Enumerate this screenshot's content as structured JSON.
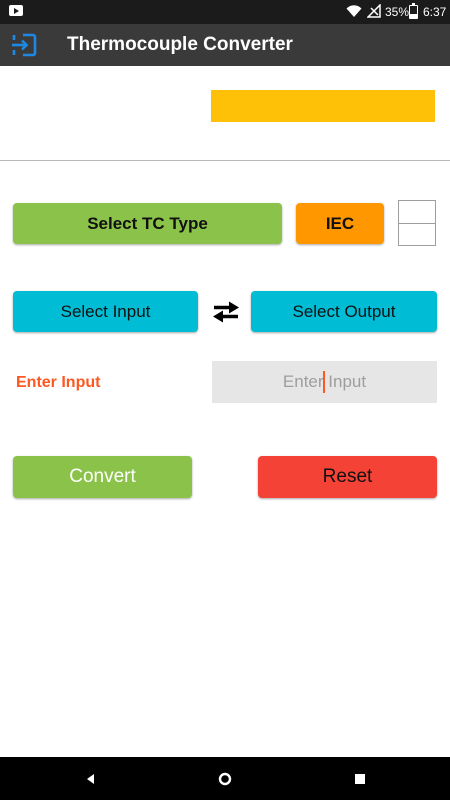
{
  "status_bar": {
    "battery": "35%",
    "time": "6:37",
    "icons": [
      "youtube-icon",
      "wifi-icon",
      "signal-icon",
      "battery-icon"
    ]
  },
  "app_bar": {
    "title": "Thermocouple Converter",
    "icon": "exit-icon"
  },
  "controls": {
    "tc_type_label": "Select TC Type",
    "standard_label": "IEC",
    "select_input_label": "Select Input",
    "select_output_label": "Select Output",
    "swap_icon": "swap-arrows-icon",
    "enter_input_label": "Enter Input",
    "input_placeholder": "Enter Input",
    "input_value": "",
    "convert_label": "Convert",
    "reset_label": "Reset"
  },
  "nav_bar": {
    "icons": [
      "back-icon",
      "home-icon",
      "recents-icon"
    ]
  },
  "colors": {
    "app_bar": "#3a3a3a",
    "result_bar": "#ffc107",
    "tc_button": "#8bc34a",
    "iec_button": "#ff9800",
    "io_buttons": "#00bcd4",
    "convert_button": "#8bc34a",
    "reset_button": "#f44336",
    "enter_label": "#ff5722",
    "exit_icon": "#1e88e5"
  }
}
